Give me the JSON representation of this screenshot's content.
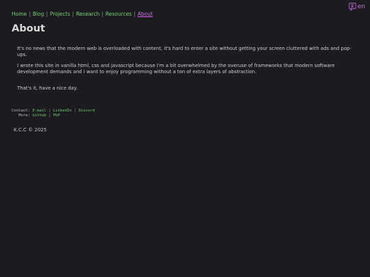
{
  "language": {
    "label": "en",
    "icon": "translate-icon"
  },
  "nav": {
    "items": [
      {
        "label": "Home"
      },
      {
        "label": "Blog"
      },
      {
        "label": "Projects"
      },
      {
        "label": "Research"
      },
      {
        "label": "Resources"
      },
      {
        "label": "About"
      }
    ],
    "separator": "|"
  },
  "page": {
    "title": "About"
  },
  "content": {
    "p1": "It's no news that the modern web is overloaded with content, it's hard to enter a site without getting your screen cluttered with ads and pop-ups.",
    "p2": "I wrote this site in vanilla html, css and javascript because I'm a bit overwhelmed by the overuse of frameworks that modern software development demands and I want to enjoy programming without a ton of extra layers of abstraction.",
    "p3": "That's it, have a nice day."
  },
  "contact": {
    "contact_label": "Contact:",
    "more_label": "More:",
    "email": "E-mail",
    "linkedin": "LinkedIn",
    "discord": "Discord",
    "github": "Github",
    "pgp": "PGP",
    "separator": "|"
  },
  "footer": {
    "text": "K.C.C © 2025"
  },
  "colors": {
    "background": "#1c1b1f",
    "link": "#6ed36a",
    "active_link": "#d069e8",
    "text": "#cfcfcf"
  }
}
